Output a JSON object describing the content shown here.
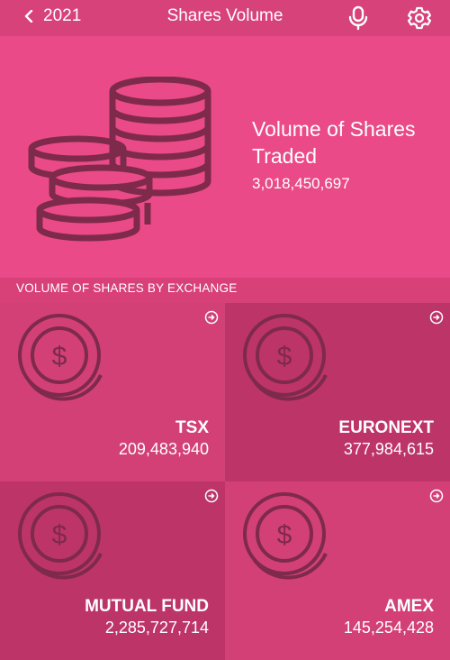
{
  "header": {
    "back_label": "2021",
    "title": "Shares Volume",
    "icons": {
      "back": "chevron-left-icon",
      "mic": "microphone-icon",
      "settings": "gear-icon"
    }
  },
  "summary": {
    "label": "Volume of Shares Traded",
    "value": "3,018,450,697",
    "icon": "coin-stack-icon"
  },
  "section_title": "VOLUME OF SHARES BY EXCHANGE",
  "exchanges": [
    {
      "name": "TSX",
      "value": "209,483,940"
    },
    {
      "name": "EURONEXT",
      "value": "377,984,615"
    },
    {
      "name": "MUTUAL FUND",
      "value": "2,285,727,714"
    },
    {
      "name": "AMEX",
      "value": "145,254,428"
    }
  ],
  "colors": {
    "header_bg": "#d7427a",
    "hero_bg": "#eb4a88",
    "section_bg": "#d84078",
    "tile_light": "#d24076",
    "tile_dark": "#bd3469",
    "icon_stroke": "#7d2a4b"
  }
}
